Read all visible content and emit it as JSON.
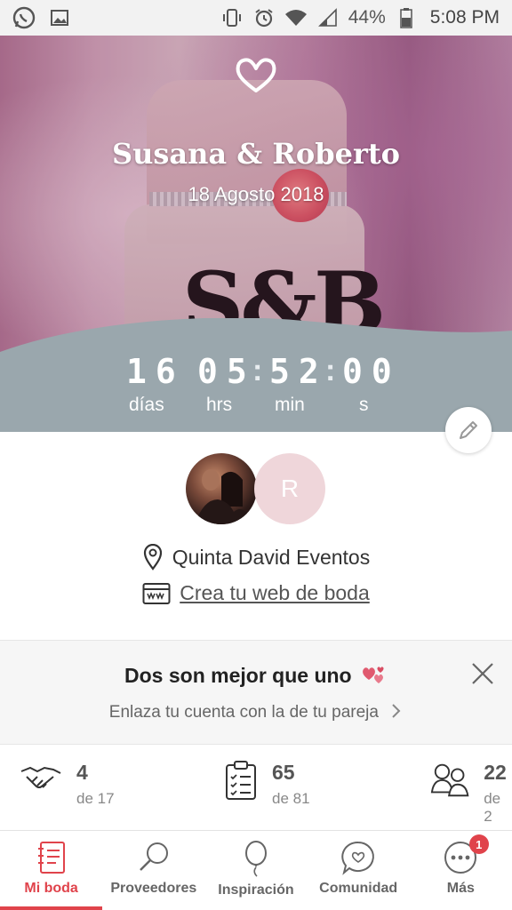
{
  "status_bar": {
    "battery": "44%",
    "time": "5:08 PM",
    "icons": [
      "whatsapp-icon",
      "image-icon",
      "vibrate-icon",
      "alarm-icon",
      "wifi-icon",
      "signal-icon",
      "battery-icon"
    ]
  },
  "hero": {
    "couple_names": "Susana & Roberto",
    "wedding_date": "18 Agosto 2018",
    "cake_monogram": "S&B"
  },
  "countdown": {
    "days": "16",
    "hours": "05",
    "minutes": "52",
    "seconds": "00",
    "days_label": "días",
    "hours_label": "hrs",
    "minutes_label": "min",
    "seconds_label": "s"
  },
  "profile": {
    "partner_initial": "R",
    "venue": "Quinta David Eventos",
    "web_link": "Crea tu web de boda"
  },
  "promo": {
    "title": "Dos son mejor que uno",
    "subtitle": "Enlaza tu cuenta con la de tu pareja"
  },
  "stats": [
    {
      "icon": "handshake-icon",
      "value": "4",
      "of": "de 17"
    },
    {
      "icon": "checklist-icon",
      "value": "65",
      "of": "de 81"
    },
    {
      "icon": "guests-icon",
      "value": "22",
      "of": "de 2"
    }
  ],
  "nav": [
    {
      "label": "Mi boda",
      "icon": "notebook-icon",
      "active": true
    },
    {
      "label": "Proveedores",
      "icon": "search-icon"
    },
    {
      "label": "Inspiración",
      "icon": "balloon-icon"
    },
    {
      "label": "Comunidad",
      "icon": "chat-heart-icon"
    },
    {
      "label": "Más",
      "icon": "more-icon",
      "badge": "1"
    }
  ],
  "colors": {
    "accent": "#e0434b",
    "countdown_band": "#9aa7ad",
    "partner_avatar": "#efd6da"
  }
}
